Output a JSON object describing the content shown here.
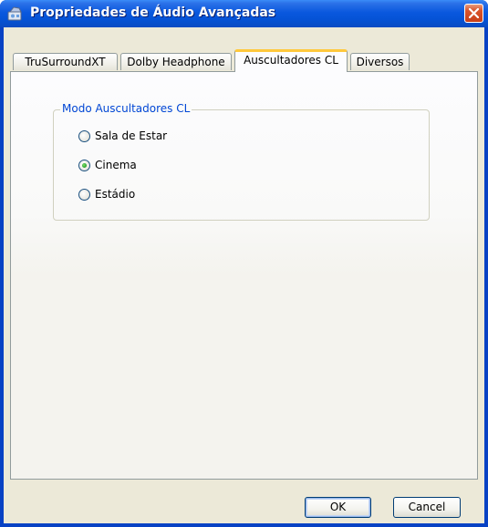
{
  "window": {
    "title": "Propriedades de Áudio Avançadas"
  },
  "tabs": [
    {
      "label": "TruSurroundXT",
      "active": false
    },
    {
      "label": "Dolby Headphone",
      "active": false
    },
    {
      "label": "Auscultadores CL",
      "active": true
    },
    {
      "label": "Diversos",
      "active": false
    }
  ],
  "group": {
    "legend": "Modo Auscultadores CL",
    "options": [
      {
        "label": "Sala de Estar",
        "checked": false
      },
      {
        "label": "Cinema",
        "checked": true
      },
      {
        "label": "Estádio",
        "checked": false
      }
    ]
  },
  "buttons": {
    "ok": "OK",
    "cancel": "Cancel"
  },
  "colors": {
    "titlebar": "#0553d6",
    "active_tab_highlight": "#ffc83c",
    "group_legend": "#0046d5",
    "close_button": "#c8401a"
  }
}
